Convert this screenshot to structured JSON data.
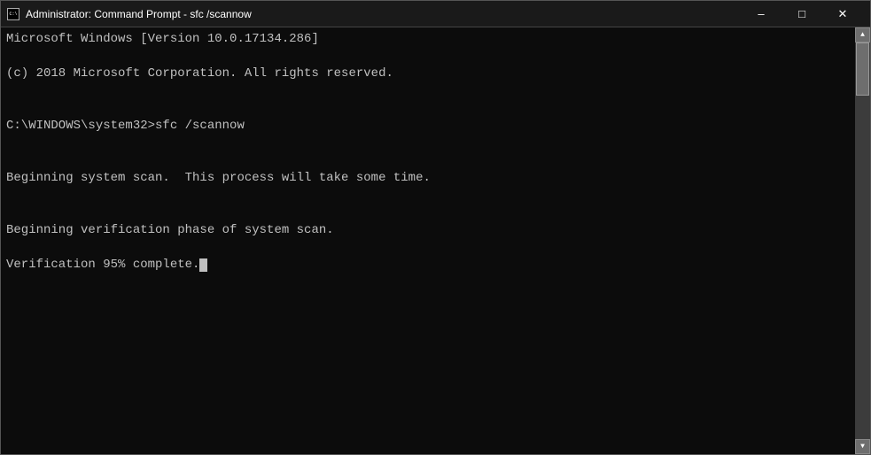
{
  "titleBar": {
    "title": "Administrator: Command Prompt - sfc /scannow",
    "minimizeLabel": "–",
    "maximizeLabel": "□",
    "closeLabel": "✕"
  },
  "terminal": {
    "lines": [
      "Microsoft Windows [Version 10.0.17134.286]",
      "(c) 2018 Microsoft Corporation. All rights reserved.",
      "",
      "C:\\WINDOWS\\system32>sfc /scannow",
      "",
      "Beginning system scan.  This process will take some time.",
      "",
      "Beginning verification phase of system scan.",
      "Verification 95% complete."
    ]
  }
}
